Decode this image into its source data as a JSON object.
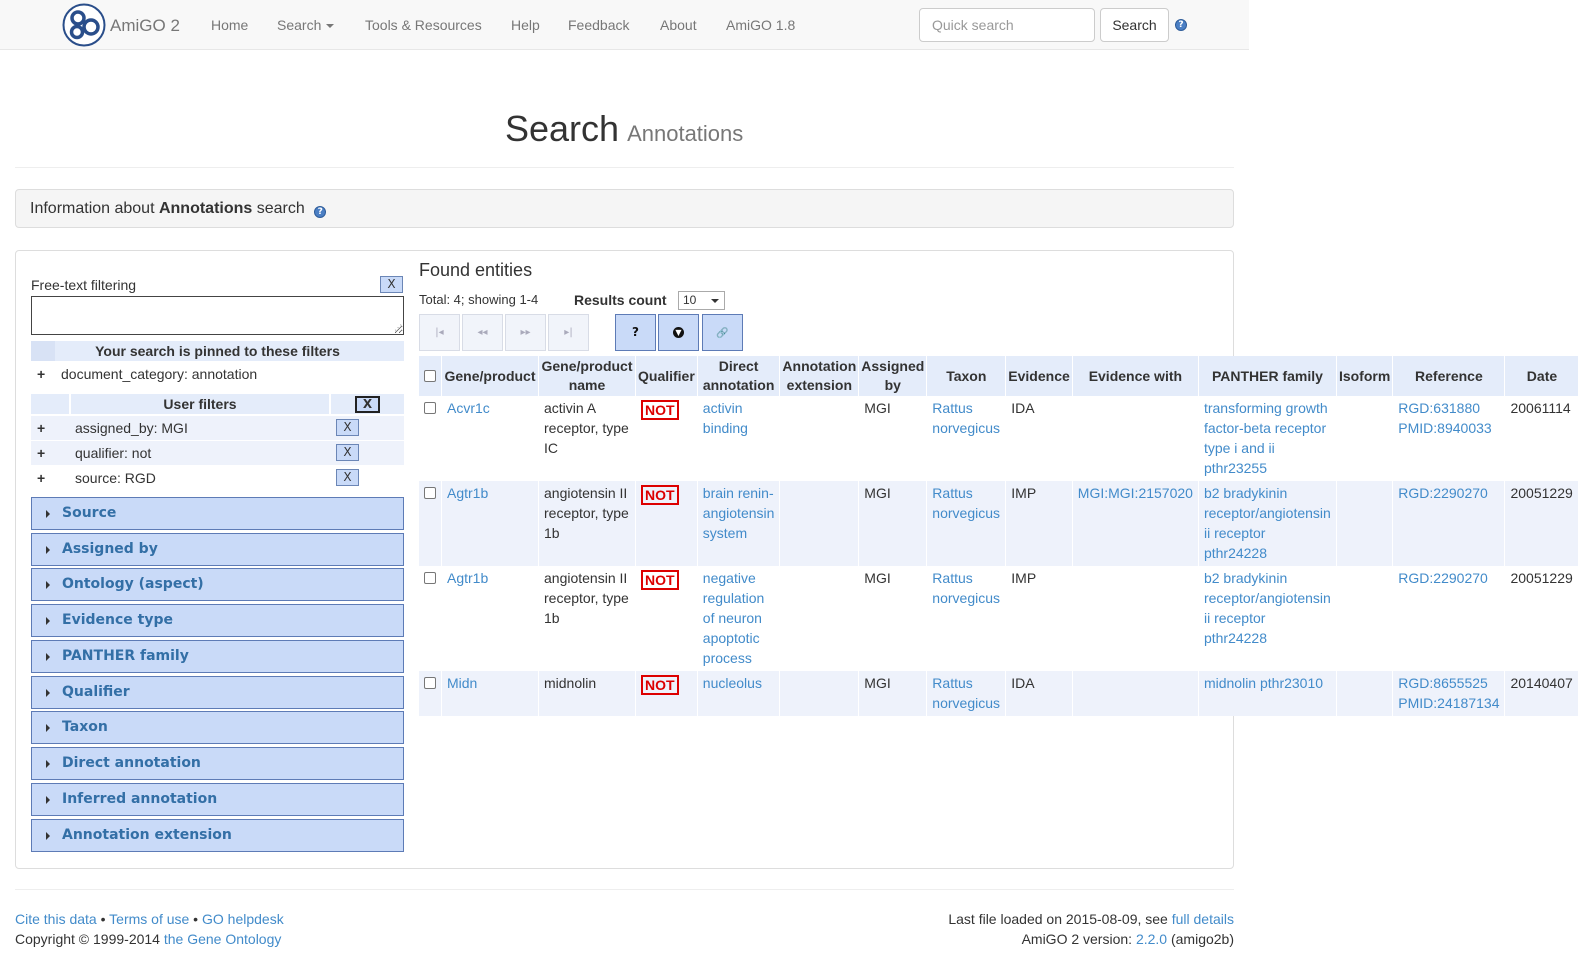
{
  "brand": "AmiGO 2",
  "nav": {
    "home": "Home",
    "search": "Search",
    "tools": "Tools & Resources",
    "help": "Help",
    "feedback": "Feedback",
    "about": "About",
    "amigo18": "AmiGO 1.8"
  },
  "quick_search": {
    "placeholder": "Quick search",
    "button": "Search"
  },
  "header": {
    "title": "Search",
    "subtitle": "Annotations"
  },
  "info": {
    "prefix": "Information about ",
    "bold": "Annotations",
    "suffix": " search"
  },
  "filter": {
    "freetext_label": "Free-text filtering",
    "x": "X",
    "pinned_title": "Your search is pinned to these filters",
    "pinned": [
      {
        "plus": "+",
        "text": "document_category: annotation"
      }
    ],
    "user_title": "User filters",
    "user": [
      {
        "plus": "+",
        "text": "assigned_by: MGI",
        "x": "X"
      },
      {
        "plus": "+",
        "text": "qualifier: not",
        "x": "X"
      },
      {
        "plus": "+",
        "text": "source: RGD",
        "x": "X"
      }
    ],
    "accordions": [
      "Source",
      "Assigned by",
      "Ontology (aspect)",
      "Evidence type",
      "PANTHER family",
      "Qualifier",
      "Taxon",
      "Direct annotation",
      "Inferred annotation",
      "Annotation extension"
    ]
  },
  "results": {
    "title": "Found entities",
    "total": "Total: 4; showing 1-4",
    "count_label": "Results count",
    "count_value": "10",
    "pager": [
      "|◂",
      "◂◂",
      "▸▸",
      "▸|"
    ],
    "tools": {
      "help": "?",
      "link": "🔗"
    },
    "columns": [
      "Gene/product",
      "Gene/product name",
      "Qualifier",
      "Direct annotation",
      "Annotation extension",
      "Assigned by",
      "Taxon",
      "Evidence",
      "Evidence with",
      "PANTHER family",
      "Isoform",
      "Reference",
      "Date"
    ],
    "rows": [
      {
        "gene": "Acvr1c",
        "name": "activin A receptor, type IC",
        "qualifier": "NOT",
        "direct": "activin binding",
        "extension": "",
        "assigned": "MGI",
        "taxon": "Rattus norvegicus",
        "evidence": "IDA",
        "with": "",
        "panther": "transforming growth factor-beta receptor type i and ii pthr23255",
        "isoform": "",
        "ref1": "RGD:631880",
        "ref2": "PMID:8940033",
        "date": "20061114"
      },
      {
        "gene": "Agtr1b",
        "name": "angiotensin II receptor, type 1b",
        "qualifier": "NOT",
        "direct": "brain renin-angiotensin system",
        "extension": "",
        "assigned": "MGI",
        "taxon": "Rattus norvegicus",
        "evidence": "IMP",
        "with": "MGI:MGI:2157020",
        "panther": "b2 bradykinin receptor/angiotensin ii receptor pthr24228",
        "isoform": "",
        "ref1": "RGD:2290270",
        "ref2": "",
        "date": "20051229"
      },
      {
        "gene": "Agtr1b",
        "name": "angiotensin II receptor, type 1b",
        "qualifier": "NOT",
        "direct": "negative regulation of neuron apoptotic process",
        "extension": "",
        "assigned": "MGI",
        "taxon": "Rattus norvegicus",
        "evidence": "IMP",
        "with": "",
        "panther": "b2 bradykinin receptor/angiotensin ii receptor pthr24228",
        "isoform": "",
        "ref1": "RGD:2290270",
        "ref2": "",
        "date": "20051229"
      },
      {
        "gene": "Midn",
        "name": "midnolin",
        "qualifier": "NOT",
        "direct": "nucleolus",
        "extension": "",
        "assigned": "MGI",
        "taxon": "Rattus norvegicus",
        "evidence": "IDA",
        "with": "",
        "panther": "midnolin pthr23010",
        "isoform": "",
        "ref1": "RGD:8655525",
        "ref2": "PMID:24187134",
        "date": "20140407"
      }
    ]
  },
  "footer": {
    "cite": "Cite this data",
    "sep": " • ",
    "terms": "Terms of use",
    "helpdesk": "GO helpdesk",
    "copyright": "Copyright © 1999-2014 ",
    "go_link": "the Gene Ontology",
    "last_loaded": "Last file loaded on 2015-08-09, see ",
    "full_details": "full details",
    "version_prefix": "AmiGO 2 version: ",
    "version": "2.2.0",
    "version_suffix": " (amigo2b)"
  }
}
